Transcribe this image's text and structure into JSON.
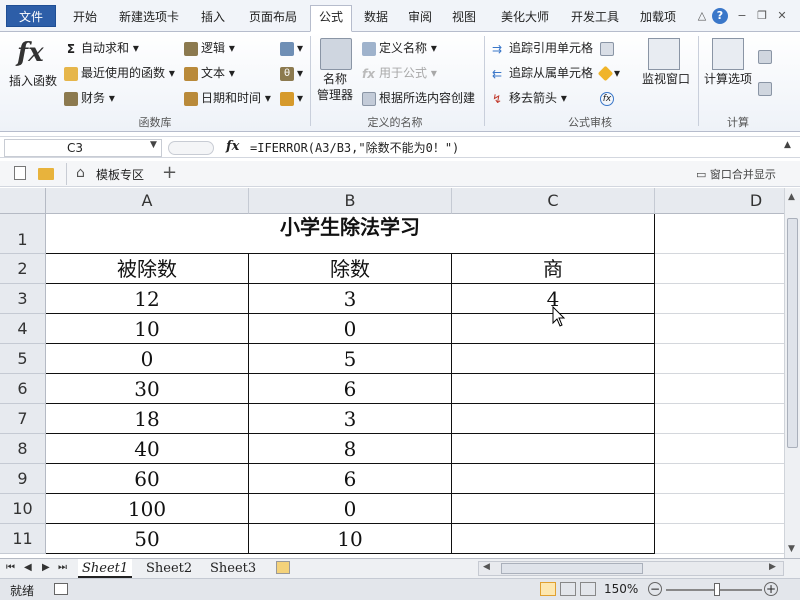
{
  "ribbon_tabs": [
    "文件",
    "开始",
    "新建选项卡",
    "插入",
    "页面布局",
    "公式",
    "数据",
    "审阅",
    "视图",
    "美化大师",
    "开发工具",
    "加载项"
  ],
  "ribbon": {
    "insert_function": "插入函数",
    "autosum": "自动求和",
    "recent": "最近使用的函数",
    "finance": "财务",
    "logic": "逻辑",
    "text": "文本",
    "datetime": "日期和时间",
    "group_funclib": "函数库",
    "name_manager_1": "名称",
    "name_manager_2": "管理器",
    "define_name": "定义名称",
    "use_in_formula": "用于公式",
    "create_from_selection": "根据所选内容创建",
    "group_defined_names": "定义的名称",
    "trace_precedents": "追踪引用单元格",
    "trace_dependents": "追踪从属单元格",
    "remove_arrows": "移去箭头",
    "watch_window": "监视窗口",
    "group_audit": "公式审核",
    "calc_options": "计算选项",
    "group_calc": "计算"
  },
  "formula_bar": {
    "name_box": "C3",
    "fx": "fx",
    "formula": "=IFERROR(A3/B3,\"除数不能为0！\")"
  },
  "workbook_bar": {
    "template_zone": "模板专区",
    "window_merge": "窗口合并显示"
  },
  "columns": [
    "A",
    "B",
    "C",
    "D"
  ],
  "rows": [
    "1",
    "2",
    "3",
    "4",
    "5",
    "6",
    "7",
    "8",
    "9",
    "10",
    "11"
  ],
  "sheet": {
    "title": "小学生除法学习",
    "headers": [
      "被除数",
      "除数",
      "商"
    ],
    "data": [
      [
        "12",
        "3",
        "4"
      ],
      [
        "10",
        "0",
        ""
      ],
      [
        "0",
        "5",
        ""
      ],
      [
        "30",
        "6",
        ""
      ],
      [
        "18",
        "3",
        ""
      ],
      [
        "40",
        "8",
        ""
      ],
      [
        "60",
        "6",
        ""
      ],
      [
        "100",
        "0",
        ""
      ],
      [
        "50",
        "10",
        ""
      ]
    ]
  },
  "sheet_tabs": [
    "Sheet1",
    "Sheet2",
    "Sheet3"
  ],
  "status": {
    "ready": "就绪",
    "zoom": "150%"
  }
}
